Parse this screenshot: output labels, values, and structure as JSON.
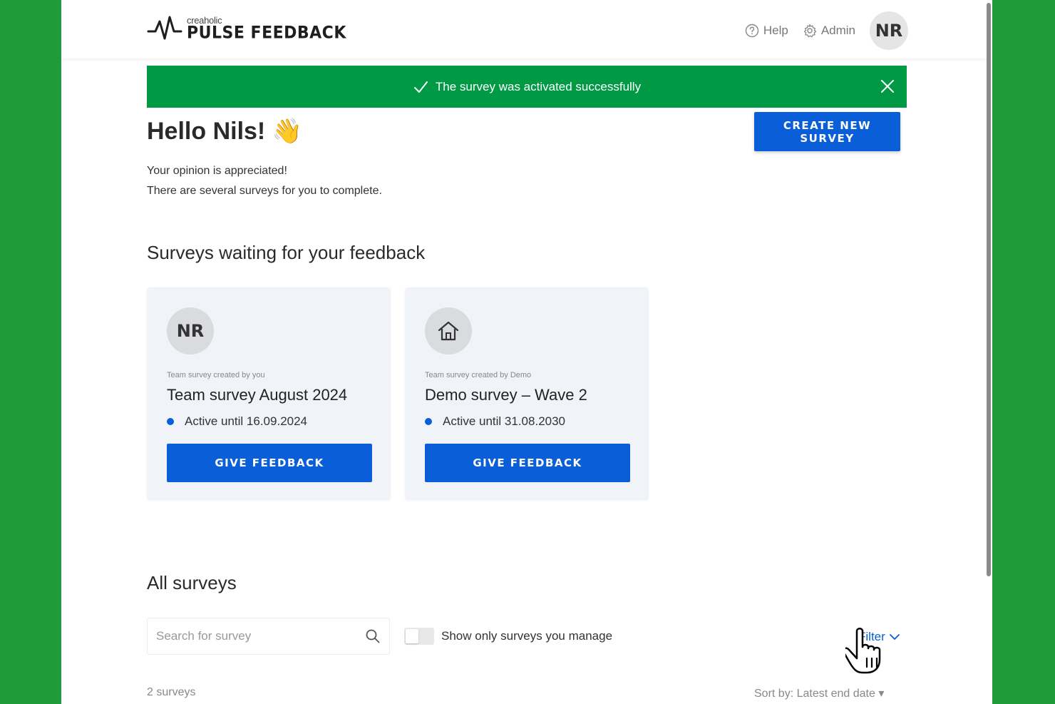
{
  "brand": {
    "small": "creaholic",
    "name": "PULSE FEEDBACK"
  },
  "nav": {
    "help": "Help",
    "admin": "Admin",
    "avatar_initials": "NR"
  },
  "banner": {
    "message": "The survey was activated successfully",
    "color": "#009a44"
  },
  "greeting": {
    "title": "Hello Nils! 👋",
    "line1": "Your opinion is appreciated!",
    "line2": "There are several surveys for you to complete."
  },
  "create_button": "CREATE NEW SURVEY",
  "waiting": {
    "title": "Surveys waiting for your feedback",
    "cards": [
      {
        "avatar": "NR",
        "meta": "Team survey created by you",
        "title": "Team survey August 2024",
        "status": "Active until 16.09.2024",
        "button": "GIVE FEEDBACK"
      },
      {
        "avatar_icon": "home-icon",
        "meta": "Team survey created by Demo",
        "title": "Demo survey – Wave 2",
        "status": "Active until 31.08.2030",
        "button": "GIVE FEEDBACK"
      }
    ]
  },
  "all_surveys": {
    "title": "All surveys",
    "search_placeholder": "Search for survey",
    "toggle_label": "Show only surveys you manage",
    "filter_label": "Filter",
    "count": "2 surveys",
    "sort": "Sort by: Latest end date ▾"
  },
  "colors": {
    "accent": "#0a5ed7",
    "background": "#1f9b3c"
  }
}
